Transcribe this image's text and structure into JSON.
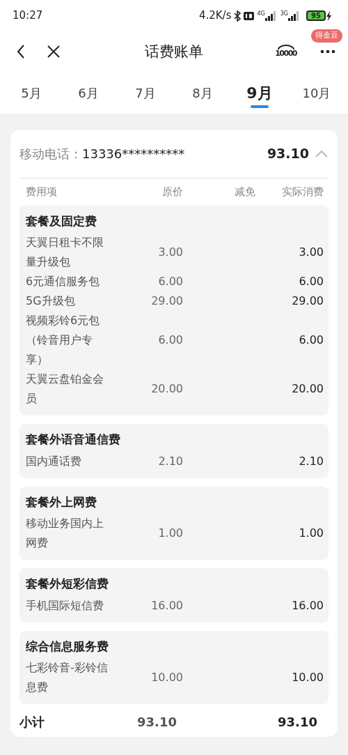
{
  "status_bar": {
    "time": "10:27",
    "net_speed": "4.2K/s",
    "sim_1": "4G",
    "sim_2": "3G",
    "battery": "95"
  },
  "header": {
    "title": "话费账单",
    "service_logo": "10000",
    "badge": "得金豆"
  },
  "tabs": [
    {
      "label": "5月",
      "selected": false
    },
    {
      "label": "6月",
      "selected": false
    },
    {
      "label": "7月",
      "selected": false
    },
    {
      "label": "8月",
      "selected": false
    },
    {
      "label": "9月",
      "selected": true
    },
    {
      "label": "10月",
      "selected": false
    }
  ],
  "account": {
    "label": "移动电话：",
    "number": "13336**********",
    "total": "93.10",
    "expanded": true
  },
  "table": {
    "columns": [
      "费用项",
      "原价",
      "减免",
      "实际消费"
    ],
    "groups": [
      {
        "title": "套餐及固定费",
        "items": [
          {
            "name": "天翼日租卡不限量升级包",
            "original": "3.00",
            "actual": "3.00"
          },
          {
            "name": "6元通信服务包",
            "original": "6.00",
            "actual": "6.00"
          },
          {
            "name": "5G升级包",
            "original": "29.00",
            "actual": "29.00"
          },
          {
            "name": "视频彩铃6元包（铃音用户专享）",
            "original": "6.00",
            "actual": "6.00"
          },
          {
            "name": "天翼云盘铂金会员",
            "original": "20.00",
            "actual": "20.00"
          }
        ]
      },
      {
        "title": "套餐外语音通信费",
        "items": [
          {
            "name": "国内通话费",
            "original": "2.10",
            "actual": "2.10"
          }
        ]
      },
      {
        "title": "套餐外上网费",
        "items": [
          {
            "name": "移动业务国内上网费",
            "original": "1.00",
            "actual": "1.00"
          }
        ]
      },
      {
        "title": "套餐外短彩信费",
        "items": [
          {
            "name": "手机国际短信费",
            "original": "16.00",
            "actual": "16.00"
          }
        ]
      },
      {
        "title": "综合信息服务费",
        "items": [
          {
            "name": "七彩铃音-彩铃信息费",
            "original": "10.00",
            "actual": "10.00"
          }
        ]
      }
    ],
    "subtotal": {
      "label": "小计",
      "original": "93.10",
      "actual": "93.10"
    }
  }
}
